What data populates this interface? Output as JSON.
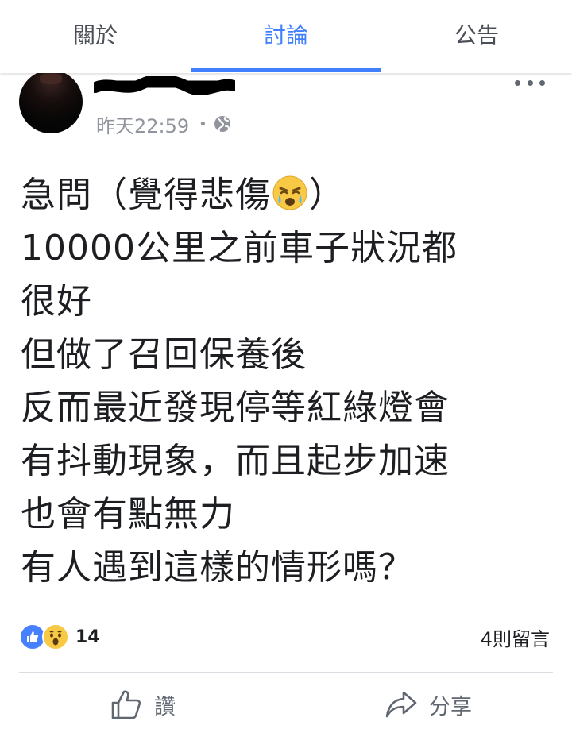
{
  "tabs": [
    {
      "label": "關於",
      "active": false
    },
    {
      "label": "討論",
      "active": true
    },
    {
      "label": "公告",
      "active": false
    }
  ],
  "post": {
    "author": "",
    "timestamp": "昨天22:59",
    "separator": "•",
    "privacy_icon": "globe-icon",
    "body_lines": [
      {
        "before": "急問（覺得悲傷",
        "emoji": "crying-face",
        "after": "）"
      },
      {
        "text": "10000公里之前車子狀況都"
      },
      {
        "text": "很好"
      },
      {
        "text": "但做了召回保養後"
      },
      {
        "text": "反而最近發現停等紅綠燈會"
      },
      {
        "text": "有抖動現象，而且起步加速"
      },
      {
        "text": "也會有點無力"
      },
      {
        "text": "有人遇到這樣的情形嗎？"
      }
    ]
  },
  "reactions": {
    "types": [
      "like",
      "wow"
    ],
    "count": "14"
  },
  "comments_count": "4則留言",
  "actions": {
    "like_label": "讚",
    "share_label": "分享"
  },
  "colors": {
    "accent": "#4080ff",
    "text": "#1c1e21",
    "secondary_text": "#90949c",
    "like_reaction": "#4680ff",
    "wow_reaction": "#f7c944"
  }
}
